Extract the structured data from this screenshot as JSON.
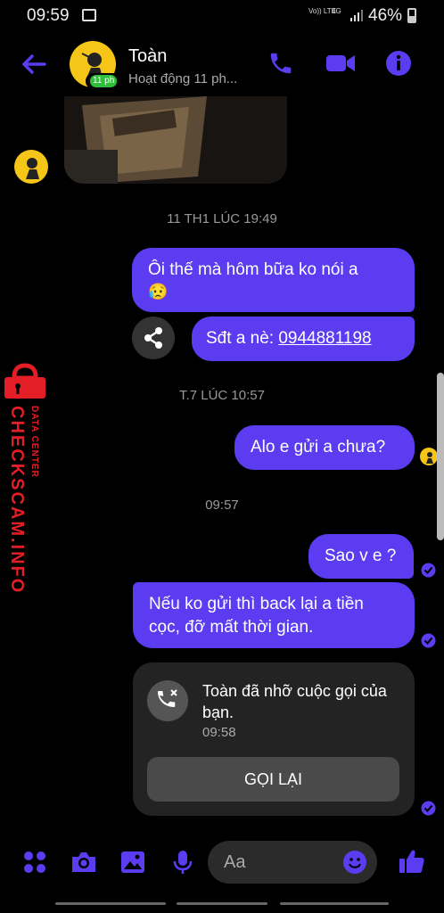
{
  "status_bar": {
    "time": "09:59",
    "volte": "Vo)) LTE",
    "network": "4G",
    "battery": "46%"
  },
  "header": {
    "contact_name": "Toàn",
    "status": "Hoạt động 11 ph...",
    "badge": "11 ph"
  },
  "messages": {
    "timestamp_1": "11 TH1 LÚC 19:49",
    "msg_1_line1": "Ôi thế mà hôm bữa ko nói a",
    "msg_1_emoji": "😥",
    "msg_2_prefix": "Sđt a nè: ",
    "msg_2_phone": "0944881198",
    "timestamp_2": "T.7 LÚC 10:57",
    "msg_3": "Alo e gửi a chưa?",
    "timestamp_3": "09:57",
    "msg_4": "Sao v e ?",
    "msg_5": "Nếu ko gửi thì back lại a tiền cọc, đỡ mất thời gian."
  },
  "missed_call": {
    "text": "Toàn đã nhỡ cuộc gọi của bạn.",
    "time": "09:58",
    "button": "GỌI LẠI"
  },
  "composer": {
    "placeholder": "Aa"
  },
  "watermark": {
    "brand": "CHECKSCAM.INFO",
    "sub": "DATA CENTER"
  },
  "colors": {
    "accent": "#5b3cf0",
    "background": "#000000",
    "watermark": "#e41e26"
  },
  "icons": [
    "back-arrow-icon",
    "phone-icon",
    "video-icon",
    "info-icon",
    "share-icon",
    "missed-call-icon",
    "menu-dots-icon",
    "camera-icon",
    "gallery-icon",
    "mic-icon",
    "emoji-icon",
    "like-icon",
    "seen-check-icon"
  ]
}
